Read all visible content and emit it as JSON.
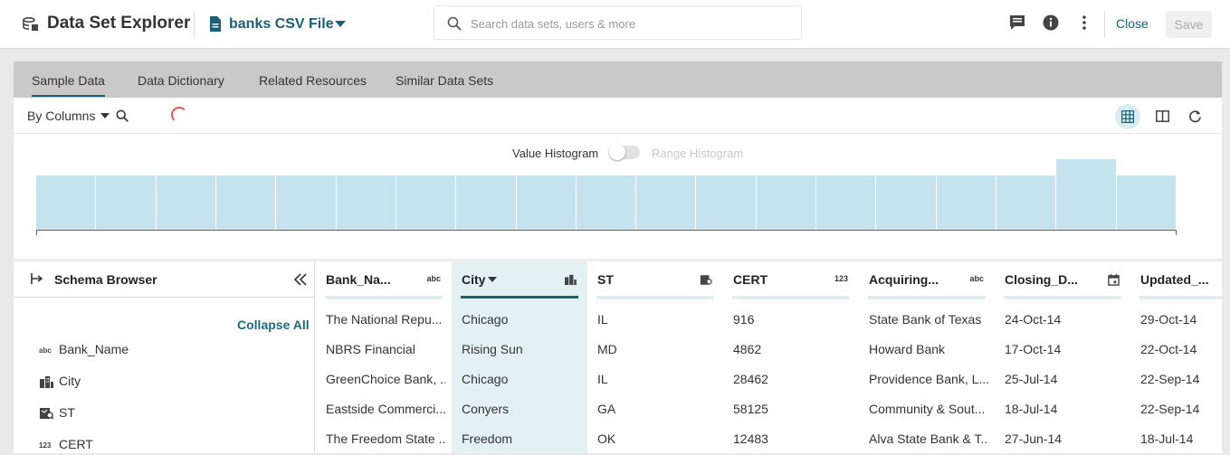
{
  "header": {
    "app_title": "Data Set Explorer",
    "app_icon": "data-stack-icon",
    "file_name": "banks CSV File",
    "file_icon": "document-icon",
    "search_placeholder": "Search data sets, users & more",
    "close_label": "Close",
    "save_label": "Save",
    "icons": [
      "comment-icon",
      "info-icon",
      "more-vertical-icon"
    ]
  },
  "tabs": [
    {
      "label": "Sample Data",
      "active": true
    },
    {
      "label": "Data Dictionary",
      "active": false
    },
    {
      "label": "Related Resources",
      "active": false
    },
    {
      "label": "Similar Data Sets",
      "active": false
    }
  ],
  "toolbar": {
    "view_mode": "By Columns",
    "icons": [
      "search-icon",
      "loading-spinner",
      "grid-view-icon",
      "split-view-icon",
      "refresh-icon"
    ]
  },
  "histogram": {
    "value_label": "Value Histogram",
    "range_label": "Range Histogram",
    "toggle_on": false,
    "bar_values": [
      0.7,
      0.7,
      0.7,
      0.7,
      0.7,
      0.7,
      0.7,
      0.7,
      0.7,
      0.7,
      0.7,
      0.7,
      0.7,
      0.7,
      0.7,
      0.7,
      0.7,
      0.9,
      0.7
    ]
  },
  "schema": {
    "title": "Schema Browser",
    "collapse_all": "Collapse All",
    "fields": [
      {
        "name": "Bank_Name",
        "type": "abc"
      },
      {
        "name": "City",
        "type": "city"
      },
      {
        "name": "ST",
        "type": "map"
      },
      {
        "name": "CERT",
        "type": "123"
      }
    ]
  },
  "grid": {
    "selected_column": "City",
    "columns": [
      {
        "title": "Bank_Na...",
        "type": "abc",
        "cells": [
          "The National Repu...",
          "NBRS Financial",
          "GreenChoice Bank, ...",
          "Eastside Commerci...",
          "The Freedom State ..."
        ]
      },
      {
        "title": "City",
        "type": "city",
        "cells": [
          "Chicago",
          "Rising Sun",
          "Chicago",
          "Conyers",
          "Freedom"
        ]
      },
      {
        "title": "ST",
        "type": "map",
        "cells": [
          "IL",
          "MD",
          "IL",
          "GA",
          "OK"
        ]
      },
      {
        "title": "CERT",
        "type": "123",
        "cells": [
          "916",
          "4862",
          "28462",
          "58125",
          "12483"
        ]
      },
      {
        "title": "Acquiring...",
        "type": "abc",
        "cells": [
          "State Bank of Texas",
          "Howard Bank",
          "Providence Bank, L...",
          "Community & Sout...",
          "Alva State Bank & T..."
        ]
      },
      {
        "title": "Closing_D...",
        "type": "date",
        "cells": [
          "24-Oct-14",
          "17-Oct-14",
          "25-Jul-14",
          "18-Jul-14",
          "27-Jun-14"
        ]
      },
      {
        "title": "Updated_...",
        "type": "date",
        "cells": [
          "29-Oct-14",
          "22-Oct-14",
          "22-Sep-14",
          "22-Sep-14",
          "18-Jul-14"
        ]
      }
    ]
  }
}
